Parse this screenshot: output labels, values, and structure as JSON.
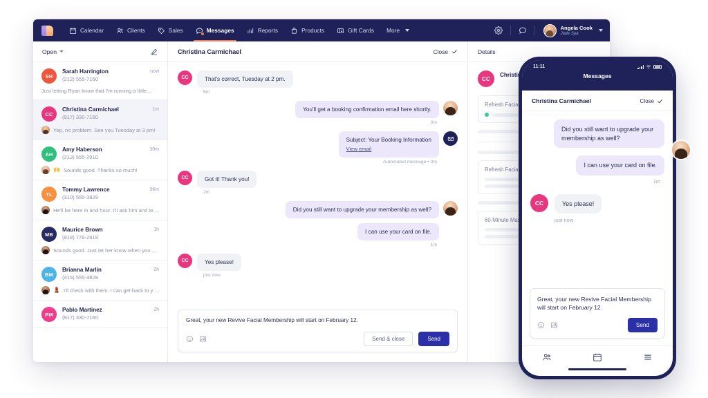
{
  "nav": {
    "logo": "boulevard-logo",
    "items": [
      {
        "label": "Calendar",
        "icon": "calendar-icon",
        "active": false
      },
      {
        "label": "Clients",
        "icon": "clients-icon",
        "active": false
      },
      {
        "label": "Sales",
        "icon": "tag-icon",
        "active": false
      },
      {
        "label": "Messages",
        "icon": "chat-icon",
        "active": true,
        "badge": true
      },
      {
        "label": "Reports",
        "icon": "bar-chart-icon",
        "active": false
      },
      {
        "label": "Products",
        "icon": "bag-icon",
        "active": false
      },
      {
        "label": "Gift Cards",
        "icon": "gift-card-icon",
        "active": false
      },
      {
        "label": "More",
        "icon": "chevron-down-icon",
        "active": false
      }
    ],
    "settings_icon": "gear-icon",
    "support_icon": "chat-bubble-icon",
    "user": {
      "name": "Angela Cook",
      "org": "Jade Spa",
      "avatar": "user-avatar"
    }
  },
  "conversations": {
    "filter_label": "Open",
    "compose_icon": "compose-icon",
    "items": [
      {
        "initials": "SH",
        "color": "#f0563c",
        "name": "Sarah Harrington",
        "phone": "(212) 555-7160",
        "time": "now",
        "preview": "Just letting Ryan know that I'm running a little…",
        "selected": false,
        "preview_avatar": null,
        "preview_emoji": null
      },
      {
        "initials": "CC",
        "color": "#e8367f",
        "name": "Christina Carmichael",
        "phone": "(917) 330-7160",
        "time": "1m",
        "preview": "Yep, no problem. See you Tuesday at 3 pm!",
        "selected": true,
        "preview_avatar": "f1",
        "preview_emoji": null
      },
      {
        "initials": "AH",
        "color": "#2fc07e",
        "name": "Amy Haberson",
        "phone": "(213) 555-2910",
        "time": "30m",
        "preview": "Sounds good. Thanks so much!",
        "selected": false,
        "preview_avatar": "f2",
        "preview_emoji": "🙌"
      },
      {
        "initials": "TL",
        "color": "#f89040",
        "name": "Tommy Lawrence",
        "phone": "(310) 555-3829",
        "time": "36m",
        "preview": "He'll be here in and hour. I'll ask him and let…",
        "selected": false,
        "preview_avatar": "f3",
        "preview_emoji": null
      },
      {
        "initials": "MB",
        "color": "#272a63",
        "name": "Maurice Brown",
        "phone": "(818) 778-2918",
        "time": "1h",
        "preview": "Sounds good. Just let her know when you g…",
        "selected": false,
        "preview_avatar": "f3",
        "preview_emoji": null
      },
      {
        "initials": "BM",
        "color": "#4cb4e8",
        "name": "Brianna Marlin",
        "phone": "(415) 555-3828",
        "time": "2h",
        "preview": "I'll check with them. I can get back to you…",
        "selected": false,
        "preview_avatar": "f3",
        "preview_emoji": "💄"
      },
      {
        "initials": "PM",
        "color": "#ef3d8a",
        "name": "Pablo Martinez",
        "phone": "(917) 330-7160",
        "time": "2h",
        "preview": "",
        "selected": false,
        "preview_avatar": null,
        "preview_emoji": null
      }
    ]
  },
  "thread": {
    "title": "Christina Carmichael",
    "close_label": "Close",
    "close_icon": "check-icon",
    "messages": [
      {
        "dir": "in",
        "avatar": "CC",
        "text": "That's correct, Tuesday at 2 pm.",
        "stamp": "5m"
      },
      {
        "dir": "out",
        "avatar": "agent",
        "text": "You'll get a booking confirmation email here shortly.",
        "stamp": "3m"
      },
      {
        "dir": "out",
        "avatar": "mail",
        "text": "Subject: Your Booking Information",
        "link": "View email",
        "stamp": "Automated message • 3m"
      },
      {
        "dir": "in",
        "avatar": "CC",
        "text": "Got it! Thank you!",
        "stamp": "2m"
      },
      {
        "dir": "out",
        "avatar": "agent",
        "text": "Did you still want to upgrade your membership as well?",
        "stamp": ""
      },
      {
        "dir": "out",
        "avatar": "none",
        "text": "I can use your card on file.",
        "stamp": "1m"
      },
      {
        "dir": "in",
        "avatar": "CC",
        "text": "Yes please!",
        "stamp": "just now"
      }
    ],
    "composer": {
      "draft": "Great, your new Revive Facial Membership will start on February 12.",
      "emoji_icon": "emoji-icon",
      "image_icon": "image-icon",
      "send_close_label": "Send & close",
      "send_label": "Send"
    }
  },
  "details": {
    "title": "Details",
    "client": {
      "initials": "CC",
      "name": "Christina Carmichael",
      "color": "#e8367f"
    },
    "cards": [
      {
        "label": "Refresh Facial",
        "status": "active"
      },
      {
        "label": "Refresh Facial",
        "status": null
      },
      {
        "label": "60-Minute Massage",
        "status": null
      }
    ]
  },
  "phone": {
    "status_time": "11:11",
    "signal_icon": "signal-icon",
    "wifi_icon": "wifi-icon",
    "battery_icon": "battery-icon",
    "app_title": "Messages",
    "thread_name": "Christina Carmichael",
    "close_label": "Close",
    "messages": [
      {
        "dir": "out",
        "text": "Did you still want to upgrade your membership as well?",
        "avatar": "agent",
        "stamp": ""
      },
      {
        "dir": "out",
        "text": "I can use your card on file.",
        "avatar": "none",
        "stamp": "1m"
      },
      {
        "dir": "in",
        "text": "Yes please!",
        "avatar": "CC",
        "stamp": "just now"
      }
    ],
    "composer": {
      "draft": "Great, your new Revive Facial Membership will start on February 12.",
      "emoji_icon": "emoji-icon",
      "image_icon": "image-icon",
      "send_label": "Send"
    },
    "tabs": [
      {
        "icon": "clients-icon",
        "name": "clients"
      },
      {
        "icon": "calendar-icon",
        "name": "calendar"
      },
      {
        "icon": "menu-icon",
        "name": "menu"
      }
    ]
  },
  "colors": {
    "brand_navy": "#1e2258",
    "accent_orange": "#f07a52",
    "primary_button": "#2b30a8",
    "bubble_out": "#ece7fb",
    "bubble_in": "#f1f2f6",
    "status_green": "#3fc98a"
  }
}
